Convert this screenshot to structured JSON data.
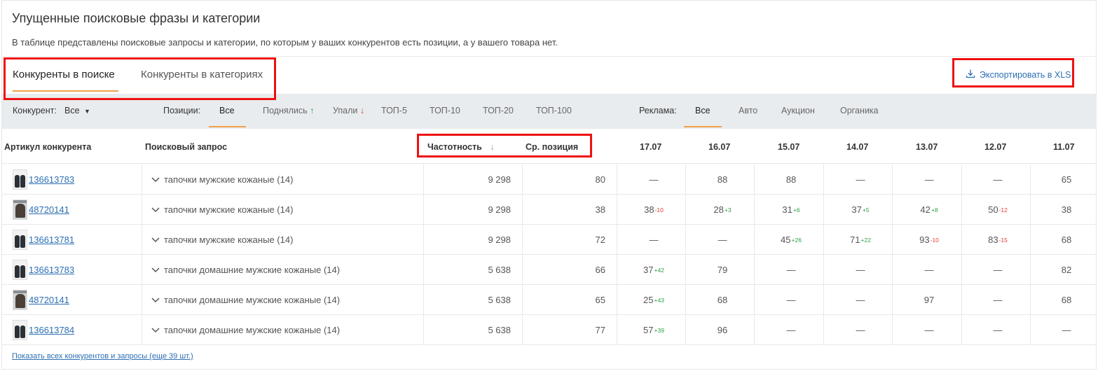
{
  "header": {
    "title": "Упущенные поисковые фразы и категории",
    "subtitle": "В таблице представлены поисковые запросы и категории, по которым у ваших конкурентов есть позиции, а у вашего товара нет."
  },
  "tabs": [
    {
      "label": "Конкуренты в поиске",
      "active": true
    },
    {
      "label": "Конкуренты в категориях",
      "active": false
    }
  ],
  "export": {
    "label": "Экспортировать в XLS",
    "icon": "download-icon"
  },
  "filters": {
    "competitor_label": "Конкурент:",
    "competitor_value": "Все",
    "positions_label": "Позиции:",
    "positions": [
      "Все",
      "Поднялись",
      "Упали",
      "ТОП-5",
      "ТОП-10",
      "ТОП-20",
      "ТОП-100"
    ],
    "positions_active": "Все",
    "ads_label": "Реклама:",
    "ads": [
      "Все",
      "Авто",
      "Аукцион",
      "Органика"
    ],
    "ads_active": "Все"
  },
  "table": {
    "columns": {
      "article": "Артикул конкурента",
      "query": "Поисковый запрос",
      "frequency": "Частотность",
      "avg_position": "Ср. позиция",
      "dates": [
        "17.07",
        "16.07",
        "15.07",
        "14.07",
        "13.07",
        "12.07",
        "11.07"
      ]
    },
    "rows": [
      {
        "article": "136613783",
        "thumb": "slippers",
        "query": "тапочки мужские кожаные (14)",
        "frequency": "9 298",
        "avg": "80",
        "days": [
          [
            "—",
            ""
          ],
          [
            "88",
            ""
          ],
          [
            "88",
            ""
          ],
          [
            "—",
            ""
          ],
          [
            "—",
            ""
          ],
          [
            "—",
            ""
          ],
          [
            "65",
            ""
          ]
        ]
      },
      {
        "article": "48720141",
        "thumb": "person",
        "query": "тапочки мужские кожаные (14)",
        "frequency": "9 298",
        "avg": "38",
        "days": [
          [
            "38",
            "-10"
          ],
          [
            "28",
            "+3"
          ],
          [
            "31",
            "+6"
          ],
          [
            "37",
            "+5"
          ],
          [
            "42",
            "+8"
          ],
          [
            "50",
            "-12"
          ],
          [
            "38",
            ""
          ]
        ]
      },
      {
        "article": "136613781",
        "thumb": "slippers",
        "query": "тапочки мужские кожаные (14)",
        "frequency": "9 298",
        "avg": "72",
        "days": [
          [
            "—",
            ""
          ],
          [
            "—",
            ""
          ],
          [
            "45",
            "+26"
          ],
          [
            "71",
            "+22"
          ],
          [
            "93",
            "-10"
          ],
          [
            "83",
            "-15"
          ],
          [
            "68",
            ""
          ]
        ]
      },
      {
        "article": "136613783",
        "thumb": "slippers",
        "query": "тапочки домашние мужские кожаные (14)",
        "frequency": "5 638",
        "avg": "66",
        "days": [
          [
            "37",
            "+42"
          ],
          [
            "79",
            ""
          ],
          [
            "—",
            ""
          ],
          [
            "—",
            ""
          ],
          [
            "—",
            ""
          ],
          [
            "—",
            ""
          ],
          [
            "82",
            ""
          ]
        ]
      },
      {
        "article": "48720141",
        "thumb": "person",
        "query": "тапочки домашние мужские кожаные (14)",
        "frequency": "5 638",
        "avg": "65",
        "days": [
          [
            "25",
            "+43"
          ],
          [
            "68",
            ""
          ],
          [
            "—",
            ""
          ],
          [
            "—",
            ""
          ],
          [
            "97",
            ""
          ],
          [
            "—",
            ""
          ],
          [
            "68",
            ""
          ]
        ]
      },
      {
        "article": "136613784",
        "thumb": "slippers",
        "query": "тапочки домашние мужские кожаные (14)",
        "frequency": "5 638",
        "avg": "77",
        "days": [
          [
            "57",
            "+39"
          ],
          [
            "96",
            ""
          ],
          [
            "—",
            ""
          ],
          [
            "—",
            ""
          ],
          [
            "—",
            ""
          ],
          [
            "—",
            ""
          ],
          [
            "—",
            ""
          ]
        ]
      }
    ]
  },
  "footer": {
    "show_all": "Показать всех конкурентов и запросы (еще 39 шт.)"
  },
  "colors": {
    "accent": "#f0a04b",
    "link": "#2d6fb3",
    "up": "#2ea043",
    "down": "#e53935",
    "highlight_box": "#ee1111"
  }
}
